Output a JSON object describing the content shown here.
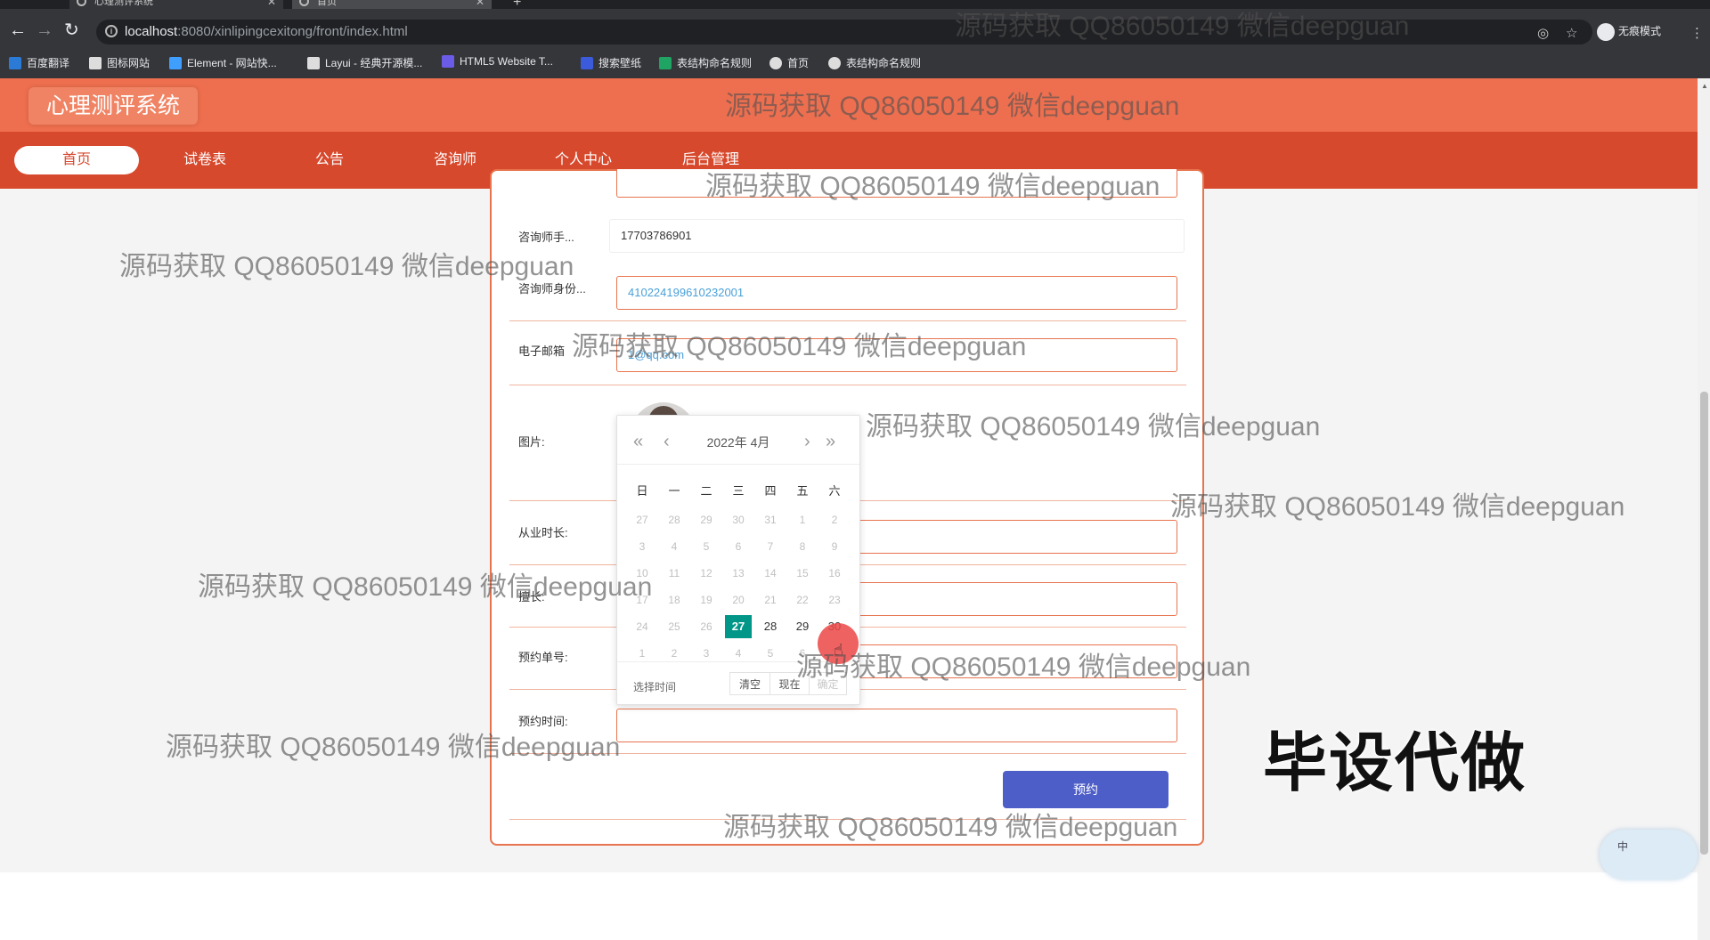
{
  "browser": {
    "tabs": [
      {
        "title": "心理测评系统"
      },
      {
        "title": "首页"
      }
    ],
    "url_host": "localhost",
    "url_rest": ":8080/xinlipingcexitong/front/index.html",
    "incognito_label": "无痕模式",
    "bookmarks": [
      {
        "label": "百度翻译",
        "color": "#2b7bd6"
      },
      {
        "label": "图标网站",
        "color": "#dddddd"
      },
      {
        "label": "Element - 网站快...",
        "color": "#409eff"
      },
      {
        "label": "Layui - 经典开源模...",
        "color": "#dddddd"
      },
      {
        "label": "HTML5 Website T...",
        "color": "#6b5ce7"
      },
      {
        "label": "搜索壁纸",
        "color": "#3b5bdb"
      },
      {
        "label": "表结构命名规则",
        "color": "#1fa463"
      },
      {
        "label": "首页",
        "color": "#dddddd"
      },
      {
        "label": "表结构命名规则",
        "color": "#dddddd"
      }
    ]
  },
  "app": {
    "logo": "心理测评系统",
    "nav": [
      {
        "label": "首页",
        "active": true
      },
      {
        "label": "试卷表"
      },
      {
        "label": "公告"
      },
      {
        "label": "咨询师"
      },
      {
        "label": "个人中心"
      },
      {
        "label": "后台管理"
      }
    ]
  },
  "form": {
    "phone_label": "咨询师手...",
    "phone_value": "17703786901",
    "idcard_label": "咨询师身份...",
    "idcard_value": "410224199610232001",
    "email_label": "电子邮箱",
    "email_value": "1@qq.com",
    "photo_label": "图片:",
    "years_label": "从业时长:",
    "specialty_label": "擅长:",
    "order_label": "预约单号:",
    "time_label": "预约时间:",
    "submit_label": "预约"
  },
  "datepicker": {
    "title": "2022年  4月",
    "prev_year": "«",
    "prev_month": "‹",
    "next_month": "›",
    "next_year": "»",
    "weekdays": [
      "日",
      "一",
      "二",
      "三",
      "四",
      "五",
      "六"
    ],
    "weeks": [
      [
        "27",
        "28",
        "29",
        "30",
        "31",
        "1",
        "2"
      ],
      [
        "3",
        "4",
        "5",
        "6",
        "7",
        "8",
        "9"
      ],
      [
        "10",
        "11",
        "12",
        "13",
        "14",
        "15",
        "16"
      ],
      [
        "17",
        "18",
        "19",
        "20",
        "21",
        "22",
        "23"
      ],
      [
        "24",
        "25",
        "26",
        "27",
        "28",
        "29",
        "30"
      ],
      [
        "1",
        "2",
        "3",
        "4",
        "5",
        "6",
        "7"
      ]
    ],
    "current_cells": [
      [
        4,
        3
      ],
      [
        4,
        4
      ],
      [
        4,
        5
      ],
      [
        4,
        6
      ]
    ],
    "selected_cell": [
      4,
      3
    ],
    "footer_label": "选择时间",
    "clear_label": "清空",
    "now_label": "现在",
    "confirm_label": "确定"
  },
  "watermark_text": "源码获取 QQ86050149 微信deepguan",
  "promo_text": "毕设代做",
  "ime_label": "中"
}
